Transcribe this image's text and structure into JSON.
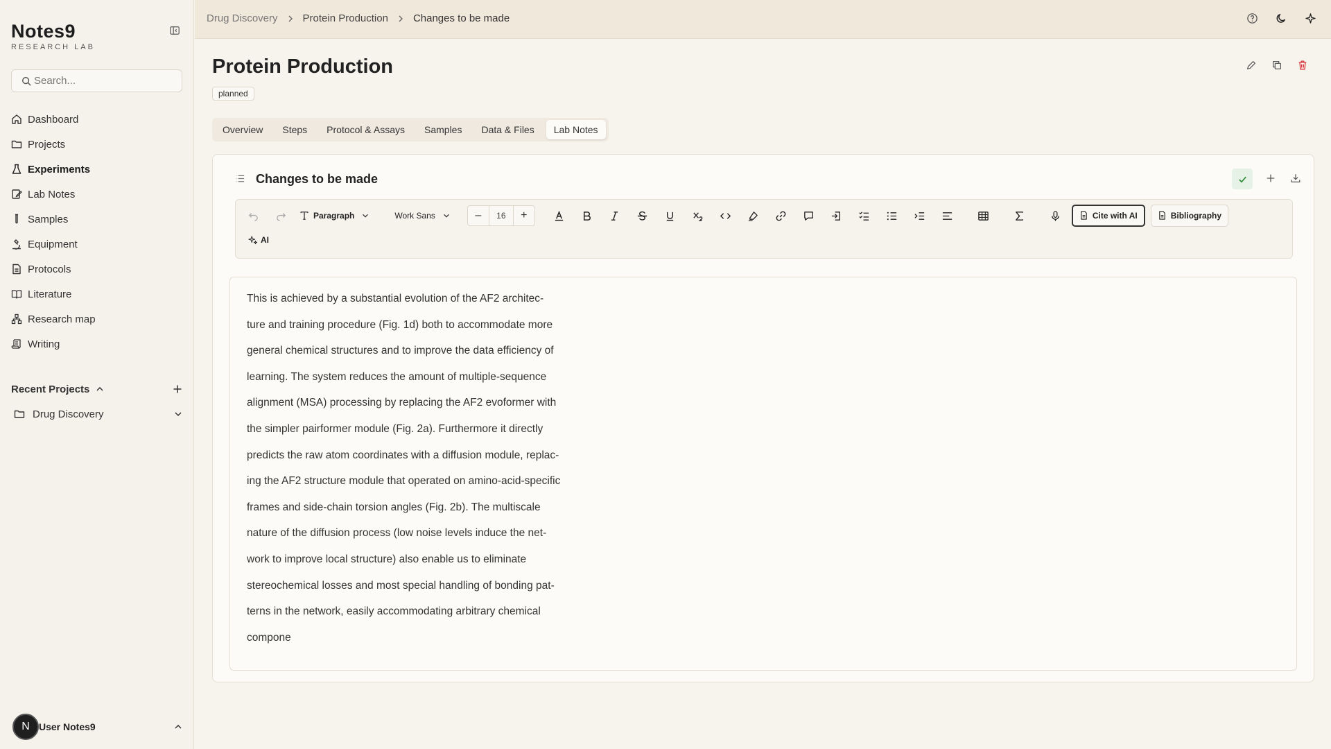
{
  "app": {
    "logo_title": "Notes9",
    "logo_subtitle": "RESEARCH LAB"
  },
  "sidebar": {
    "search_placeholder": "Search...",
    "items": [
      {
        "label": "Dashboard",
        "icon": "home-icon"
      },
      {
        "label": "Projects",
        "icon": "folder-icon"
      },
      {
        "label": "Experiments",
        "icon": "flask-icon",
        "active": true
      },
      {
        "label": "Lab Notes",
        "icon": "note-edit-icon"
      },
      {
        "label": "Samples",
        "icon": "test-tube-icon"
      },
      {
        "label": "Equipment",
        "icon": "microscope-icon"
      },
      {
        "label": "Protocols",
        "icon": "document-icon"
      },
      {
        "label": "Literature",
        "icon": "book-icon"
      },
      {
        "label": "Research map",
        "icon": "network-icon"
      },
      {
        "label": "Writing",
        "icon": "scroll-icon"
      }
    ],
    "recent_label": "Recent Projects",
    "recent_items": [
      {
        "label": "Drug Discovery"
      }
    ],
    "user": {
      "initial": "N",
      "name": "User Notes9"
    }
  },
  "header": {
    "breadcrumb": [
      "Drug Discovery",
      "Protein Production",
      "Changes to be made"
    ]
  },
  "page": {
    "title": "Protein Production",
    "status": "planned",
    "tabs": [
      "Overview",
      "Steps",
      "Protocol & Assays",
      "Samples",
      "Data & Files",
      "Lab Notes"
    ],
    "active_tab": "Lab Notes"
  },
  "note": {
    "title": "Changes to be made",
    "toolbar": {
      "block_type": "Paragraph",
      "font": "Work Sans",
      "font_size": "16",
      "cite_label": "Cite with AI",
      "bibliography_label": "Bibliography",
      "ai_label": "AI"
    },
    "body": "This is achieved by a substantial evolution of the AF2 architec-\nture and training procedure (Fig. 1d) both to accommodate more\ngeneral chemical structures and to improve the data efficiency of\nlearning. The system reduces the amount of multiple-sequence\nalignment (MSA) processing by replacing the AF2 evoformer with\nthe simpler pairformer module (Fig. 2a). Furthermore it directly\npredicts the raw atom coordinates with a diffusion module, replac-\ning the AF2 structure module that operated on amino-acid-specific\nframes and side-chain torsion angles (Fig. 2b). The multiscale\nnature of the diffusion process (low noise levels induce the net-\nwork to improve local structure) also enable us to eliminate\nstereochemical losses and most special handling of bonding pat-\nterns in the network, easily accommodating arbitrary chemical\ncompone"
  },
  "colors": {
    "background": "#f7f4ee",
    "topbar": "#f1e8dc",
    "danger": "#d9363e",
    "success": "#2e8b3a"
  }
}
